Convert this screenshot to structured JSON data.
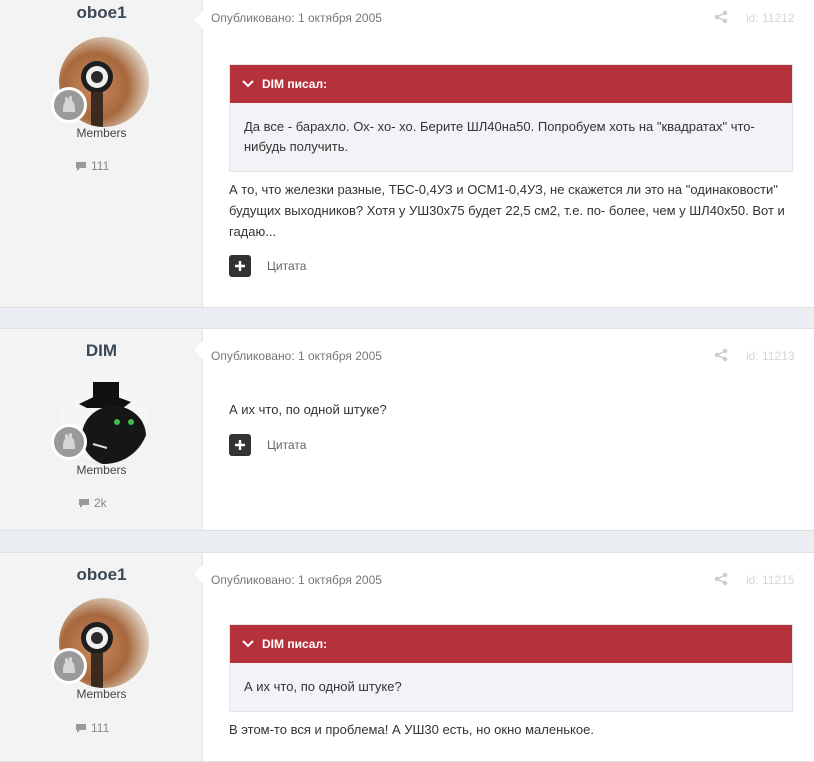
{
  "posts": [
    {
      "author": "oboe1",
      "avatar": "oboe-avatar",
      "group": "Members",
      "post_count": "111",
      "published": "Опубликовано: 1 октября 2005",
      "post_id": "id: 11212",
      "quote": {
        "header": "DIM писал:",
        "text": "Да все - барахло. Ох- хо- хо. Берите ШЛ40на50. Попробуем хоть на \"квадратах\" что-нибудь получить."
      },
      "text": "А то, что железки разные, ТБС-0,4УЗ и ОСМ1-0,4УЗ, не скажется ли это на \"одинаковости\" будущих выходников? Хотя у УШ30х75 будет 22,5 см2, т.е. по- более, чем у ШЛ40х50. Вот и гадаю...",
      "quote_button": "Цитата"
    },
    {
      "author": "DIM",
      "avatar": "cat-avatar",
      "group": "Members",
      "post_count": "2k",
      "published": "Опубликовано: 1 октября 2005",
      "post_id": "id: 11213",
      "text": "А их что, по одной штуке?",
      "quote_button": "Цитата"
    },
    {
      "author": "oboe1",
      "avatar": "oboe-avatar",
      "group": "Members",
      "post_count": "111",
      "published": "Опубликовано: 1 октября 2005",
      "post_id": "id: 11215",
      "quote": {
        "header": "DIM писал:",
        "text": "А их что, по одной штуке?"
      },
      "text": "В этом-то вся и проблема! А УШ30 есть, но окно маленькое."
    }
  ],
  "colors": {
    "quote_header": "#b5313b",
    "author_name": "#3b4856",
    "page_bg": "#ebeef2"
  }
}
